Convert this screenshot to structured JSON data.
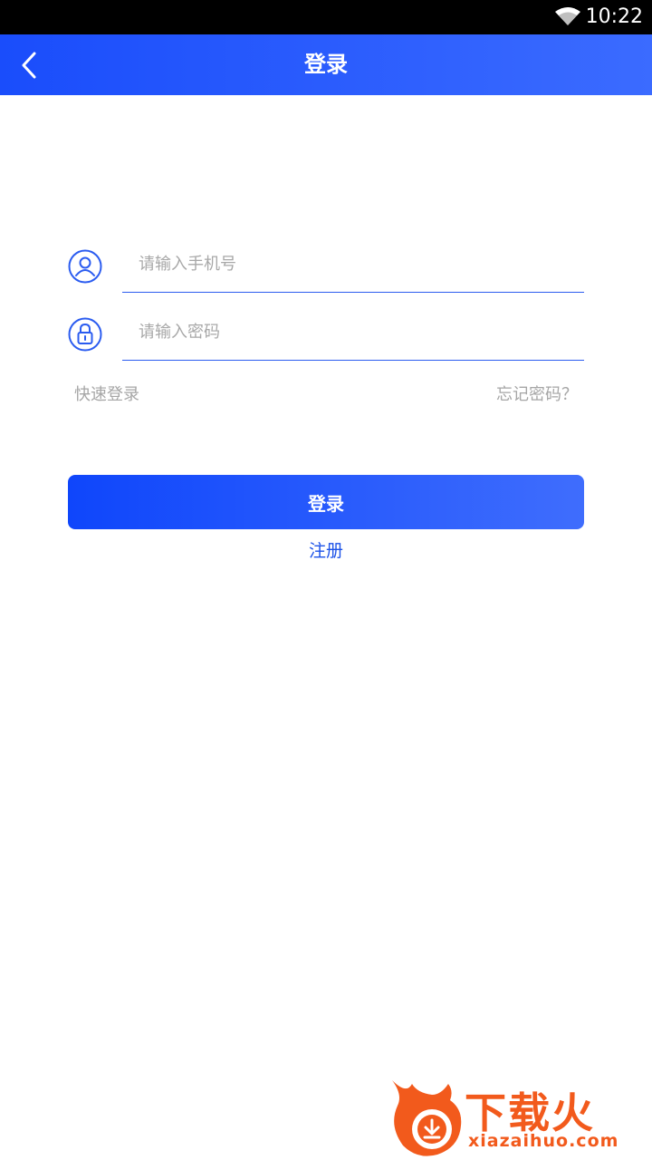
{
  "status_bar": {
    "time": "10:22",
    "wifi_icon": "wifi-icon"
  },
  "app_bar": {
    "title": "登录",
    "back_icon": "chevron-left-icon"
  },
  "form": {
    "phone": {
      "placeholder": "请输入手机号",
      "value": "",
      "icon": "user-icon"
    },
    "password": {
      "placeholder": "请输入密码",
      "value": "",
      "icon": "lock-icon"
    },
    "quick_login": "快速登录",
    "forgot_password": "忘记密码？",
    "login_button": "登录",
    "register_link": "注册"
  },
  "watermark": {
    "brand": "下载火",
    "domain": "xiazaihuo.com"
  },
  "colors": {
    "accent": "#1a4dfb",
    "accent_light": "#3f6dfd",
    "placeholder": "#a8a8a8",
    "link_gray": "#a6a6a6",
    "watermark": "#f25a1c"
  }
}
